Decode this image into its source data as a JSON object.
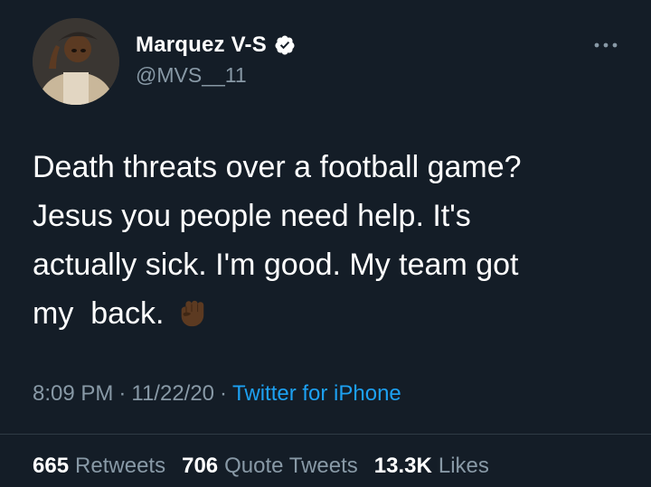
{
  "colors": {
    "background": "#141d27",
    "text": "#ffffff",
    "muted": "#8899a6",
    "link": "#1da1f2",
    "verified": "#ffffff"
  },
  "author": {
    "display_name": "Marquez V-S",
    "handle": "@MVS__11",
    "verified_icon": "verified-badge-icon",
    "avatar_icon": "profile-avatar"
  },
  "more_icon": "more-options-icon",
  "tweet": {
    "text_lines": [
      "Death threats over a football game?",
      "Jesus you people need help. It's",
      "actually sick. I'm good. My team got",
      "my  back. "
    ],
    "emoji": "raised-fist-dark-skin-tone"
  },
  "meta": {
    "time": "8:09 PM",
    "separator": "·",
    "date": "11/22/20",
    "source": "Twitter for iPhone"
  },
  "stats": [
    {
      "count": "665",
      "label": "Retweets"
    },
    {
      "count": "706",
      "label": "Quote Tweets"
    },
    {
      "count": "13.3K",
      "label": "Likes"
    }
  ]
}
